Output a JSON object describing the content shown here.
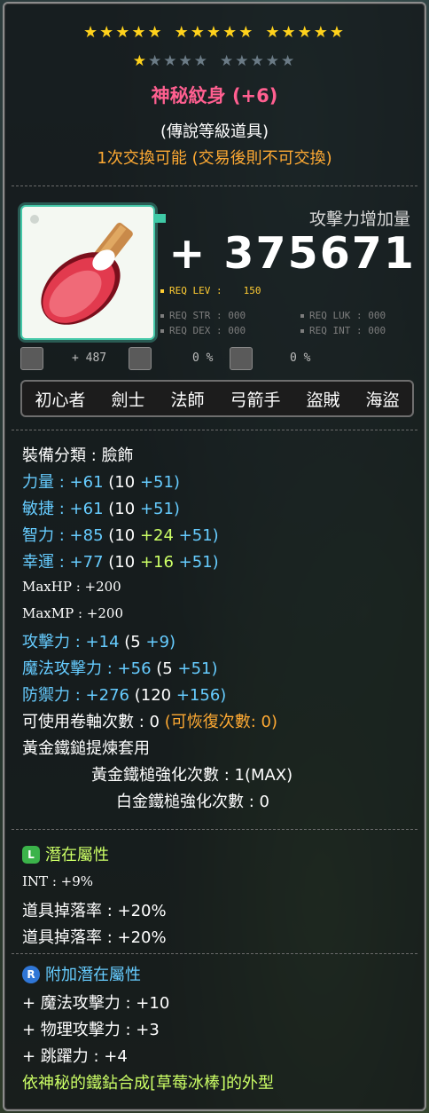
{
  "stars": {
    "row1_groups": [
      "★★★★★",
      "★★★★★",
      "★★★★★"
    ],
    "row2_on": "★",
    "row2_off_a": "★★★★",
    "row2_off_b": "★★★★★"
  },
  "item": {
    "name": "神秘紋身 (+6)",
    "grade": "(傳說等級道具)",
    "trade": "1次交換可能 (交易後則不可交換)",
    "image_icon": "strawberry-ice-pop-icon"
  },
  "attack_increase": {
    "label": "攻擊力增加量",
    "value": "+ 375671"
  },
  "requirements": {
    "lev_label": "REQ LEV :",
    "lev_value": "150",
    "str": "REQ STR : 000",
    "luk": "REQ LUK : 000",
    "dex": "REQ DEX : 000",
    "int": "REQ INT : 000"
  },
  "statline": {
    "plus": "+ 487",
    "pct1": "0 %",
    "pct2": "0 %"
  },
  "jobs": [
    "初心者",
    "劍士",
    "法師",
    "弓箭手",
    "盜賊",
    "海盜"
  ],
  "stats": {
    "category": "裝備分類 : 臉飾",
    "str": {
      "label": "力量 :",
      "total": "+61",
      "base": "(10",
      "a": "+51)"
    },
    "dex": {
      "label": "敏捷 :",
      "total": "+61",
      "base": "(10",
      "a": "+51)"
    },
    "int": {
      "label": "智力 :",
      "total": "+85",
      "base": "(10",
      "b": "+24",
      "a": "+51)"
    },
    "luk": {
      "label": "幸運 :",
      "total": "+77",
      "base": "(10",
      "b": "+16",
      "a": "+51)"
    },
    "maxhp": "MaxHP : +200",
    "maxmp": "MaxMP : +200",
    "atk": {
      "label": "攻擊力 :",
      "total": "+14",
      "base": "(5",
      "a": "+9)"
    },
    "matk": {
      "label": "魔法攻擊力 :",
      "total": "+56",
      "base": "(5",
      "a": "+51)"
    },
    "def": {
      "label": "防禦力 :",
      "total": "+276",
      "base": "(120",
      "a": "+156)"
    },
    "scroll": "可使用卷軸次數 : 0",
    "scroll_recover": "(可恢復次數: 0)",
    "hammer": "黃金鐵鎚提煉套用",
    "gold_hammer": "黃金鐵槌強化次數 : 1(MAX)",
    "plat_hammer": "白金鐵槌強化次數 : 0"
  },
  "potential": {
    "badge": "L",
    "title": "潛在屬性",
    "lines": [
      "INT : +9%",
      "道具掉落率 : +20%",
      "道具掉落率 : +20%"
    ]
  },
  "bonus": {
    "badge": "R",
    "title": "附加潛在屬性",
    "lines": [
      "+ 魔法攻擊力 : +10",
      "+ 物理攻擊力 : +3",
      "+ 跳躍力 : +4"
    ]
  },
  "description": "依神秘的鐵鉆合成[草莓冰棒]的外型",
  "colors": {
    "title": "#ff5f90",
    "trade": "#ffaa33",
    "stat_blue": "#66ccff",
    "potential_green": "#ccff66",
    "frame_teal": "#44c8a8"
  }
}
